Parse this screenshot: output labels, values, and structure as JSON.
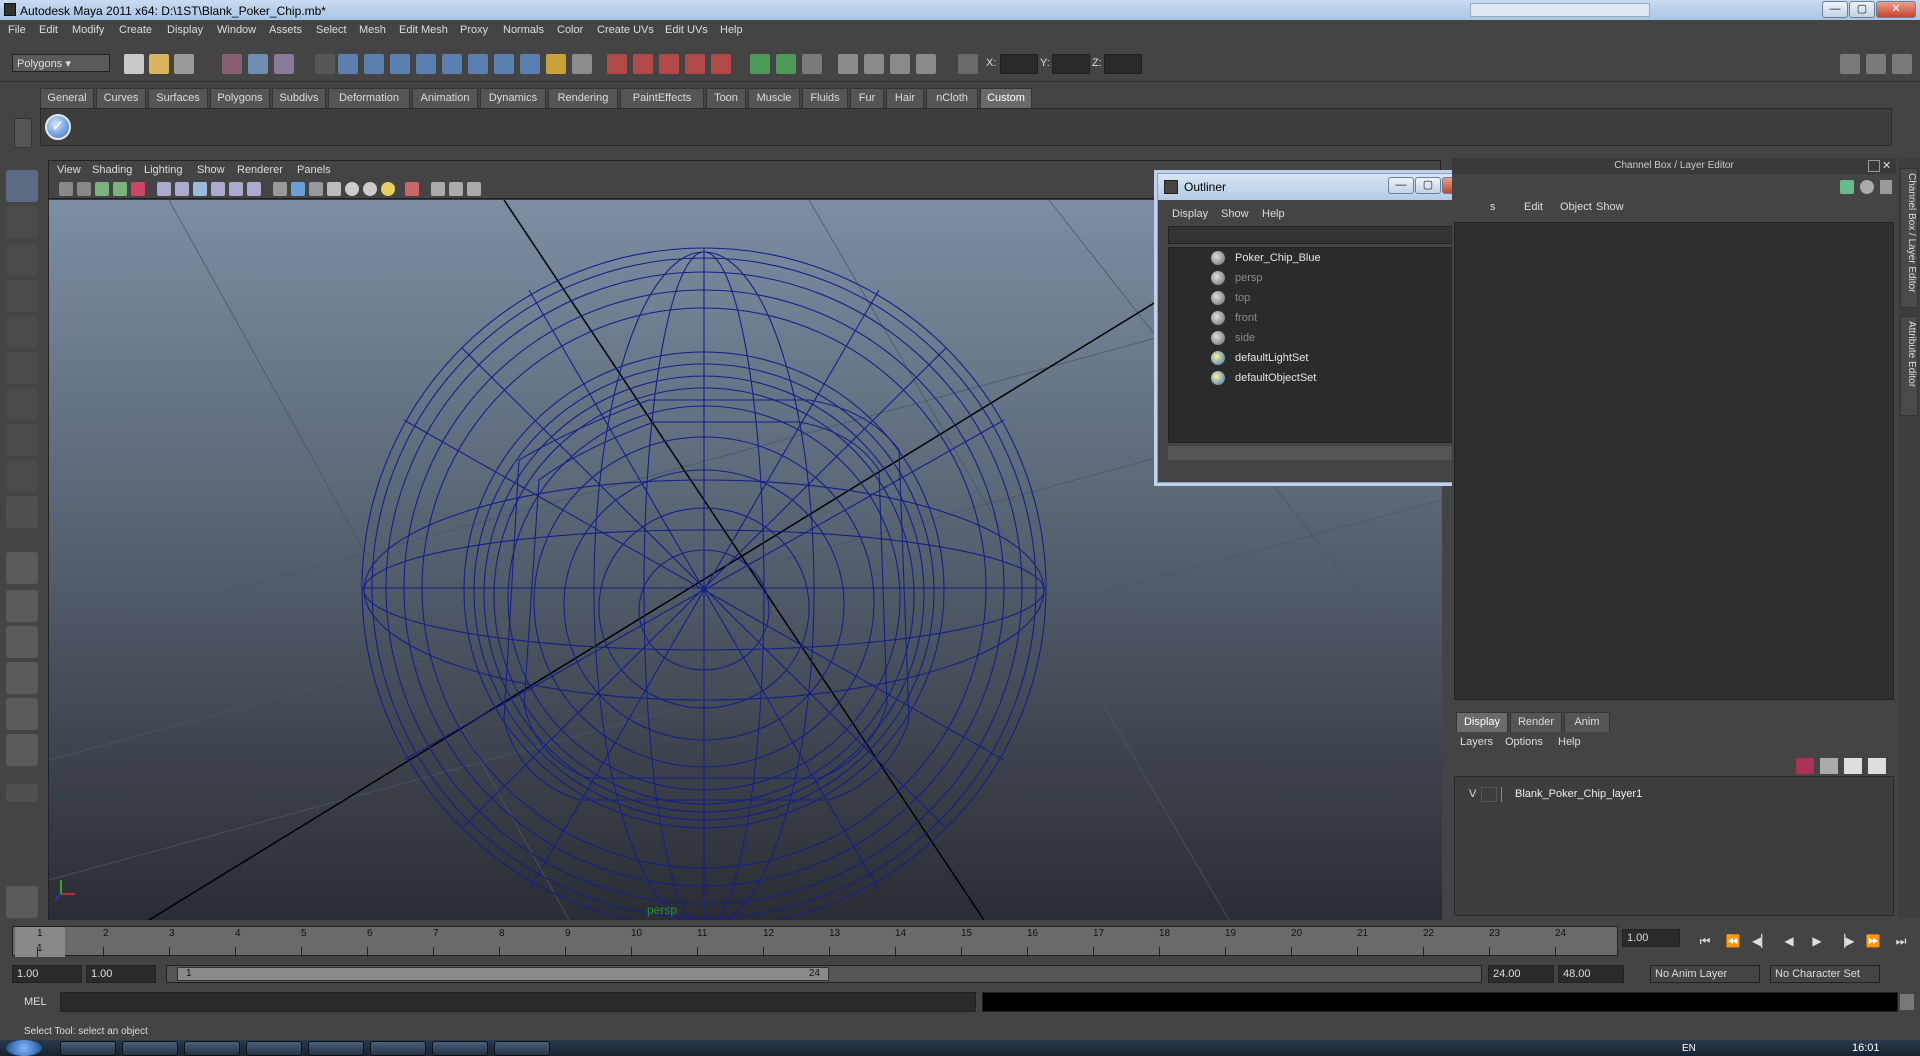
{
  "window": {
    "title": "Autodesk Maya 2011 x64: D:\\1ST\\Blank_Poker_Chip.mb*",
    "buttons": {
      "minimize": "—",
      "maximize": "▢",
      "close": "✕"
    }
  },
  "menubar": [
    "File",
    "Edit",
    "Modify",
    "Create",
    "Display",
    "Window",
    "Assets",
    "Select",
    "Mesh",
    "Edit Mesh",
    "Proxy",
    "Normals",
    "Color",
    "Create UVs",
    "Edit UVs",
    "Help"
  ],
  "statusline": {
    "mode": "Polygons",
    "coords": {
      "x": "X:",
      "y": "Y:",
      "z": "Z:"
    }
  },
  "shelf": {
    "tabs": [
      "General",
      "Curves",
      "Surfaces",
      "Polygons",
      "Subdivs",
      "Deformation",
      "Animation",
      "Dynamics",
      "Rendering",
      "PaintEffects",
      "Toon",
      "Muscle",
      "Fluids",
      "Fur",
      "Hair",
      "nCloth",
      "Custom"
    ],
    "active_tab": "Custom"
  },
  "viewport": {
    "menu": [
      "View",
      "Shading",
      "Lighting",
      "Show",
      "Renderer",
      "Panels"
    ],
    "camera_label": "persp"
  },
  "outliner": {
    "title": "Outliner",
    "menu": [
      "Display",
      "Show",
      "Help"
    ],
    "items": [
      {
        "label": "Poker_Chip_Blue",
        "dim": false,
        "kind": "transform"
      },
      {
        "label": "persp",
        "dim": true,
        "kind": "camera"
      },
      {
        "label": "top",
        "dim": true,
        "kind": "camera"
      },
      {
        "label": "front",
        "dim": true,
        "kind": "camera"
      },
      {
        "label": "side",
        "dim": true,
        "kind": "camera"
      },
      {
        "label": "defaultLightSet",
        "dim": false,
        "kind": "set"
      },
      {
        "label": "defaultObjectSet",
        "dim": false,
        "kind": "set"
      }
    ]
  },
  "channelbox": {
    "title": "Channel Box / Layer Editor",
    "menu": [
      "Edit",
      "Object",
      "Show"
    ],
    "partial_first_menu": "s",
    "layer_tabs": [
      "Display",
      "Render",
      "Anim"
    ],
    "active_layer_tab": "Display",
    "layer_menu": [
      "Layers",
      "Options",
      "Help"
    ],
    "layer": {
      "visible": "V",
      "name": "Blank_Poker_Chip_layer1"
    },
    "side_tabs": [
      "Channel Box / Layer Editor",
      "Attribute Editor"
    ]
  },
  "timeline": {
    "ticks": [
      "1",
      "2",
      "3",
      "4",
      "5",
      "6",
      "7",
      "8",
      "9",
      "10",
      "11",
      "12",
      "13",
      "14",
      "15",
      "16",
      "17",
      "18",
      "19",
      "20",
      "21",
      "22",
      "23",
      "24"
    ],
    "current_frame": "1",
    "current_time_field": "1.00",
    "range_start": "1.00",
    "range_inner_start": "1.00",
    "range_bar_start": "1",
    "range_bar_end": "24",
    "anim_end": "24.00",
    "range_end": "48.00",
    "anim_layer": "No Anim Layer",
    "character_set": "No Character Set"
  },
  "mel": {
    "label": "MEL"
  },
  "helpline": {
    "text": "Select Tool: select an object"
  },
  "taskbar": {
    "lang": "EN",
    "clock": "16:01"
  }
}
